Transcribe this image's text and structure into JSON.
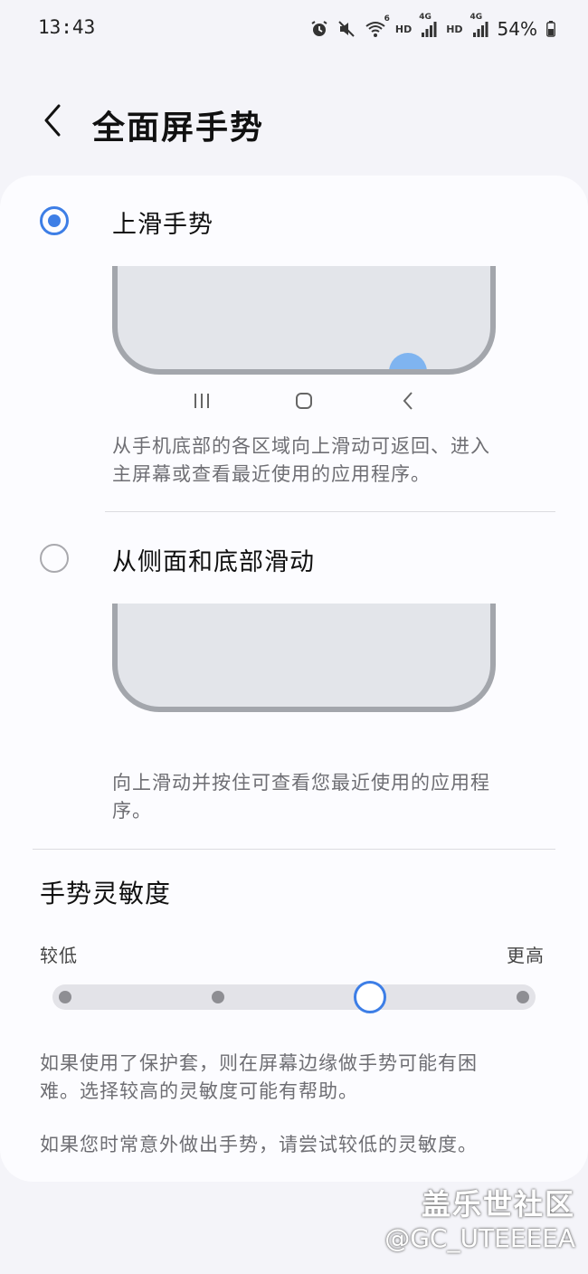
{
  "status_bar": {
    "time": "13:43",
    "hd1": "HD",
    "net1": "4G",
    "hd2": "HD",
    "net2": "4G",
    "wifi_level": "6",
    "battery_percent": "54%"
  },
  "header": {
    "title": "全面屏手势"
  },
  "options": [
    {
      "label": "上滑手势",
      "selected": true,
      "description_line1": "从手机底部的各区域向上滑动可返回、进入",
      "description_line2": "主屏幕或查看最近使用的应用程序。"
    },
    {
      "label": "从侧面和底部滑动",
      "selected": false,
      "description_line1": "向上滑动并按住可查看您最近使用的应用程",
      "description_line2": "序。"
    }
  ],
  "sensitivity": {
    "title": "手势灵敏度",
    "low_label": "较低",
    "high_label": "更高",
    "steps": 4,
    "current_step": 3
  },
  "notes": {
    "note1_line1": "如果使用了保护套，则在屏幕边缘做手势可能有困",
    "note1_line2": "难。选择较高的灵敏度可能有帮助。",
    "note2": "如果您时常意外做出手势，请尝试较低的灵敏度。"
  },
  "watermark": {
    "brand": "盖乐世社区",
    "handle": "@GC_UTEEEEA"
  },
  "colors": {
    "accent": "#3d7ee6",
    "background": "#f4f4f9",
    "card": "#fcfcff"
  }
}
